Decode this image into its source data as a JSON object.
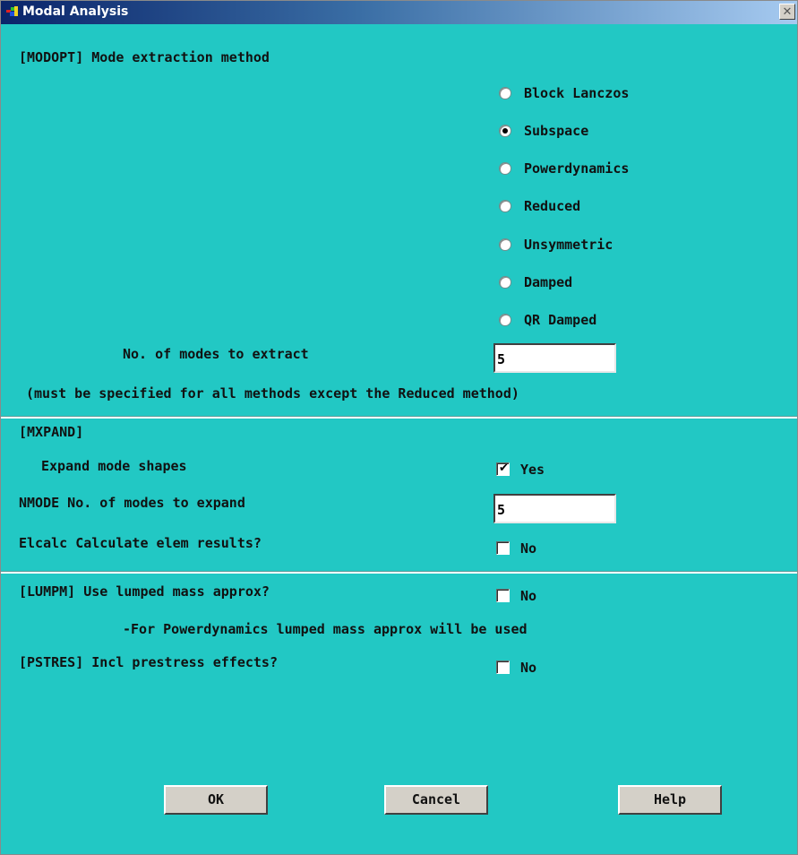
{
  "window": {
    "title": "Modal Analysis",
    "close_icon": "close-icon",
    "close_glyph": "✕"
  },
  "modopt": {
    "header": "[MODOPT] Mode extraction method",
    "methods": [
      {
        "label": "Block Lanczos",
        "selected": false
      },
      {
        "label": "Subspace",
        "selected": true
      },
      {
        "label": "Powerdynamics",
        "selected": false
      },
      {
        "label": "Reduced",
        "selected": false
      },
      {
        "label": "Unsymmetric",
        "selected": false
      },
      {
        "label": "Damped",
        "selected": false
      },
      {
        "label": "QR Damped",
        "selected": false
      }
    ],
    "num_modes_label": "No. of modes to extract",
    "num_modes_value": "5",
    "note": "(must be specified for all methods except the Reduced method)"
  },
  "mxpand": {
    "header": "[MXPAND]",
    "expand_label": "Expand mode shapes",
    "expand_value_label": "Yes",
    "expand_checked": true,
    "nmode_label": "NMODE No. of modes to expand",
    "nmode_value": "5",
    "elcalc_label": "Elcalc  Calculate elem results?",
    "elcalc_value_label": "No",
    "elcalc_checked": false
  },
  "lumpm": {
    "label": "[LUMPM]  Use lumped mass approx?",
    "value_label": "No",
    "checked": false,
    "note": "-For Powerdynamics lumped mass approx will be used"
  },
  "pstres": {
    "label": "[PSTRES] Incl prestress effects?",
    "value_label": "No",
    "checked": false
  },
  "buttons": {
    "ok": "OK",
    "cancel": "Cancel",
    "help": "Help"
  },
  "colors": {
    "dialog_bg": "#22c8c4",
    "titlebar_start": "#0a246a",
    "titlebar_end": "#a6caf0",
    "button_face": "#d4d0c8"
  }
}
